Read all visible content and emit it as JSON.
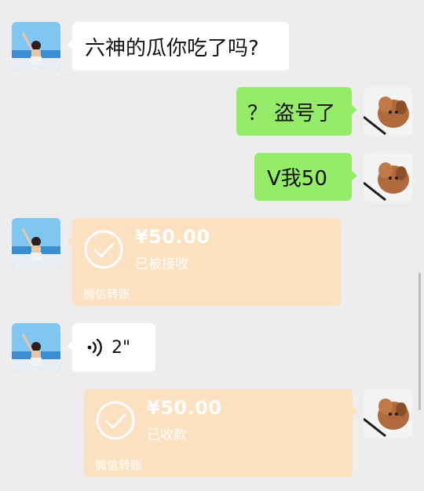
{
  "chat": {
    "messages": [
      {
        "side": "left",
        "type": "text",
        "text": "六神的瓜你吃了吗?"
      },
      {
        "side": "right",
        "type": "text",
        "text": "？ 盗号了"
      },
      {
        "side": "right",
        "type": "text",
        "text": "V我50"
      },
      {
        "side": "left",
        "type": "transfer",
        "amount": "¥50.00",
        "status": "已被接收",
        "brand": "微信转账"
      },
      {
        "side": "left",
        "type": "voice",
        "duration": "2\""
      },
      {
        "side": "right",
        "type": "transfer",
        "amount": "¥50.00",
        "status": "已收款",
        "brand": "微信转账"
      }
    ]
  },
  "colors": {
    "background": "#ededed",
    "bubble_white": "#ffffff",
    "bubble_green": "#95ec69",
    "transfer_card": "#fbe1c0"
  }
}
